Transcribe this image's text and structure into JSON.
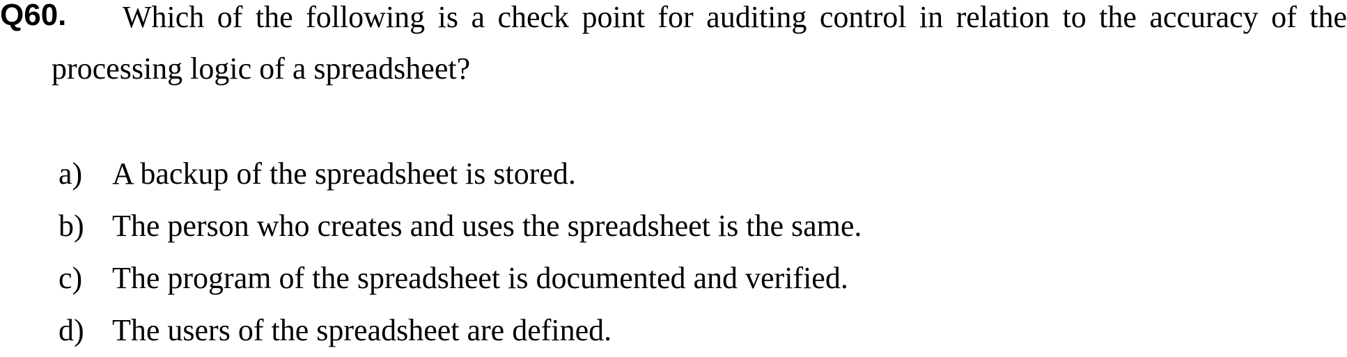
{
  "question": {
    "number": "Q60.",
    "text": "Which of the following is a check point for auditing control in relation to the accuracy of the processing logic of a spreadsheet?"
  },
  "options": [
    {
      "letter": "a)",
      "text": "A backup of the spreadsheet is stored."
    },
    {
      "letter": "b)",
      "text": "The person who creates and uses the spreadsheet is the same."
    },
    {
      "letter": "c)",
      "text": "The program of the spreadsheet is documented and verified."
    },
    {
      "letter": "d)",
      "text": "The users of the spreadsheet are defined."
    }
  ]
}
